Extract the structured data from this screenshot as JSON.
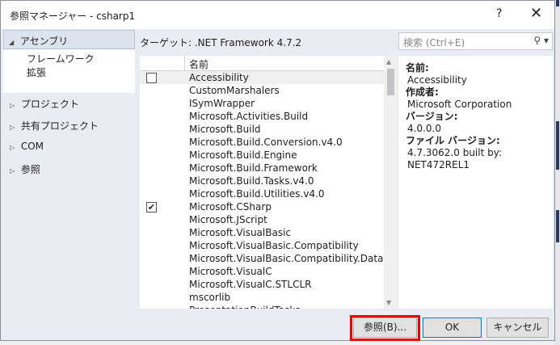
{
  "window": {
    "title": "参照マネージャー - csharp1",
    "help": "?",
    "close": "✕"
  },
  "sidebar": {
    "selected": "アセンブリ",
    "sub_items": [
      "フレームワーク",
      "拡張"
    ],
    "nodes": [
      "プロジェクト",
      "共有プロジェクト",
      "COM",
      "参照"
    ]
  },
  "target": "ターゲット: .NET Framework 4.7.2",
  "search": {
    "placeholder": "検索 (Ctrl+E)"
  },
  "list": {
    "header": "名前",
    "rows": [
      {
        "name": "Accessibility",
        "checked": false
      },
      {
        "name": "CustomMarshalers"
      },
      {
        "name": "ISymWrapper"
      },
      {
        "name": "Microsoft.Activities.Build"
      },
      {
        "name": "Microsoft.Build"
      },
      {
        "name": "Microsoft.Build.Conversion.v4.0"
      },
      {
        "name": "Microsoft.Build.Engine"
      },
      {
        "name": "Microsoft.Build.Framework"
      },
      {
        "name": "Microsoft.Build.Tasks.v4.0"
      },
      {
        "name": "Microsoft.Build.Utilities.v4.0"
      },
      {
        "name": "Microsoft.CSharp",
        "checked": true
      },
      {
        "name": "Microsoft.JScript"
      },
      {
        "name": "Microsoft.VisualBasic"
      },
      {
        "name": "Microsoft.VisualBasic.Compatibility"
      },
      {
        "name": "Microsoft.VisualBasic.Compatibility.Data"
      },
      {
        "name": "Microsoft.VisualC"
      },
      {
        "name": "Microsoft.VisualC.STLCLR"
      },
      {
        "name": "mscorlib"
      },
      {
        "name": "PresentationBuildTasks"
      }
    ]
  },
  "details": {
    "name_label": "名前:",
    "name": "Accessibility",
    "author_label": "作成者:",
    "author": "Microsoft Corporation",
    "version_label": "バージョン:",
    "version": "4.0.0.0",
    "file_version_label": "ファイル バージョン:",
    "file_version": "4.7.3062.0 built by: NET472REL1"
  },
  "buttons": {
    "browse": "参照(B)...",
    "ok": "OK",
    "cancel": "キャンセル"
  },
  "colors": {
    "highlight": "#ee0000",
    "ok_border": "#0078d7"
  }
}
